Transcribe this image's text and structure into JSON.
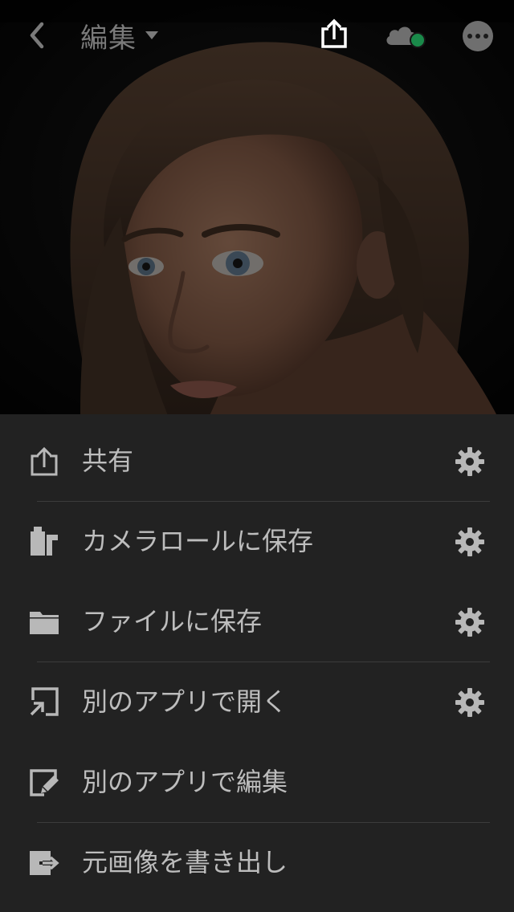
{
  "header": {
    "title": "編集"
  },
  "menu": {
    "items": [
      {
        "label": "共有",
        "icon": "share-icon",
        "has_settings": true
      },
      {
        "label": "カメラロールに保存",
        "icon": "camera-roll-icon",
        "has_settings": true
      },
      {
        "label": "ファイルに保存",
        "icon": "folder-icon",
        "has_settings": true
      },
      {
        "label": "別のアプリで開く",
        "icon": "open-in-icon",
        "has_settings": true
      },
      {
        "label": "別のアプリで編集",
        "icon": "edit-in-icon",
        "has_settings": false
      },
      {
        "label": "元画像を書き出し",
        "icon": "export-original-icon",
        "has_settings": false
      }
    ]
  },
  "colors": {
    "sheet_background": "#222222",
    "label_text": "#bdbdbd",
    "icon": "#b8b8b8",
    "sync_status": "#1a8a4a"
  }
}
